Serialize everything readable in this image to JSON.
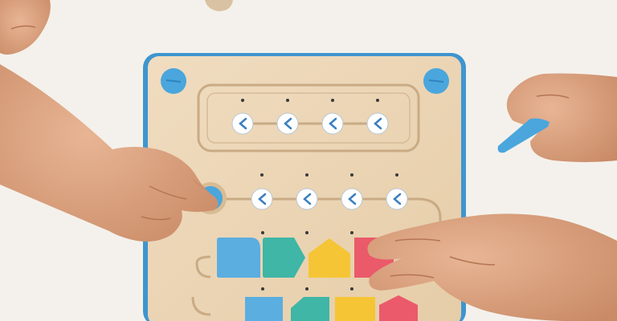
{
  "scene": {
    "description_colors": {
      "table": "#f4f1ec",
      "board_wood": "#ecd7b6",
      "board_rim": "#3f95cf",
      "button_blue": "#4aa6dc",
      "block_blue": "#5aaee0",
      "block_teal": "#3fb6a6",
      "block_yellow": "#f5c536",
      "block_red": "#ea5a6a",
      "skin": "#d9a07e"
    },
    "slot_icon": "chevron-left-icon"
  }
}
